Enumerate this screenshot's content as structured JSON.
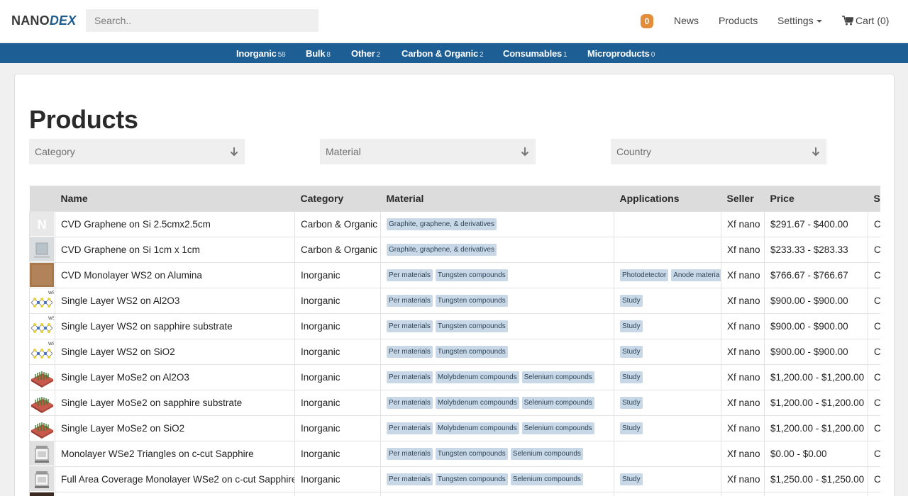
{
  "header": {
    "logo_main": "NANO",
    "logo_accent": "DEX",
    "search_placeholder": "Search..",
    "notif_count": "0",
    "nav": {
      "news": "News",
      "products": "Products",
      "settings": "Settings",
      "cart": "Cart (0)"
    }
  },
  "categories": [
    {
      "name": "Inorganic",
      "count": "58"
    },
    {
      "name": "Bulk",
      "count": "8"
    },
    {
      "name": "Other",
      "count": "2"
    },
    {
      "name": "Carbon & Organic",
      "count": "2"
    },
    {
      "name": "Consumables",
      "count": "1"
    },
    {
      "name": "Microproducts",
      "count": "0"
    }
  ],
  "page": {
    "title": "Products"
  },
  "filters": {
    "category": "Category",
    "material": "Material",
    "country": "Country"
  },
  "table": {
    "headers": {
      "name": "Name",
      "category": "Category",
      "material": "Material",
      "applications": "Applications",
      "seller": "Seller",
      "price": "Price",
      "ship": "Sh"
    },
    "rows": [
      {
        "thumb": "letter-n",
        "name": "CVD Graphene on Si 2.5cmx2.5cm",
        "category": "Carbon & Organic",
        "materials": [
          "Graphite, graphene, & derivatives"
        ],
        "applications": [],
        "seller": "Xf nano",
        "price": "$291.67 - $400.00",
        "ship": "C"
      },
      {
        "thumb": "wafer-photo",
        "name": "CVD Graphene on Si 1cm x 1cm",
        "category": "Carbon & Organic",
        "materials": [
          "Graphite, graphene, & derivatives"
        ],
        "applications": [],
        "seller": "Xf nano",
        "price": "$233.33 - $283.33",
        "ship": "C"
      },
      {
        "thumb": "brown-sample",
        "name": "CVD Monolayer WS2 on Alumina",
        "category": "Inorganic",
        "materials": [
          "Per materials",
          "Tungsten compounds"
        ],
        "applications": [
          "Photodetector",
          "Anode materia"
        ],
        "seller": "Xf nano",
        "price": "$766.67 - $766.67",
        "ship": "C"
      },
      {
        "thumb": "ws2-lattice",
        "name": "Single Layer WS2 on Al2O3",
        "category": "Inorganic",
        "materials": [
          "Per materials",
          "Tungsten compounds"
        ],
        "applications": [
          "Study"
        ],
        "seller": "Xf nano",
        "price": "$900.00 - $900.00",
        "ship": "C"
      },
      {
        "thumb": "ws2-lattice",
        "name": "Single Layer WS2 on sapphire substrate",
        "category": "Inorganic",
        "materials": [
          "Per materials",
          "Tungsten compounds"
        ],
        "applications": [
          "Study"
        ],
        "seller": "Xf nano",
        "price": "$900.00 - $900.00",
        "ship": "C"
      },
      {
        "thumb": "ws2-lattice",
        "name": "Single Layer WS2 on SiO2",
        "category": "Inorganic",
        "materials": [
          "Per materials",
          "Tungsten compounds"
        ],
        "applications": [
          "Study"
        ],
        "seller": "Xf nano",
        "price": "$900.00 - $900.00",
        "ship": "C"
      },
      {
        "thumb": "mose2-crystal",
        "name": "Single Layer MoSe2 on Al2O3",
        "category": "Inorganic",
        "materials": [
          "Per materials",
          "Molybdenum compounds",
          "Selenium compounds"
        ],
        "applications": [
          "Study"
        ],
        "seller": "Xf nano",
        "price": "$1,200.00 - $1,200.00",
        "ship": "C"
      },
      {
        "thumb": "mose2-crystal",
        "name": "Single Layer MoSe2 on sapphire substrate",
        "category": "Inorganic",
        "materials": [
          "Per materials",
          "Molybdenum compounds",
          "Selenium compounds"
        ],
        "applications": [
          "Study"
        ],
        "seller": "Xf nano",
        "price": "$1,200.00 - $1,200.00",
        "ship": "C"
      },
      {
        "thumb": "mose2-crystal",
        "name": "Single Layer MoSe2 on SiO2",
        "category": "Inorganic",
        "materials": [
          "Per materials",
          "Molybdenum compounds",
          "Selenium compounds"
        ],
        "applications": [
          "Study"
        ],
        "seller": "Xf nano",
        "price": "$1,200.00 - $1,200.00",
        "ship": "C"
      },
      {
        "thumb": "sample-box",
        "name": "Monolayer WSe2 Triangles on c-cut Sapphire",
        "category": "Inorganic",
        "materials": [
          "Per materials",
          "Tungsten compounds",
          "Selenium compounds"
        ],
        "applications": [],
        "seller": "Xf nano",
        "price": "$0.00 - $0.00",
        "ship": "C"
      },
      {
        "thumb": "sample-box",
        "name": "Full Area Coverage Monolayer WSe2 on c-cut Sapphire",
        "category": "Inorganic",
        "materials": [
          "Per materials",
          "Tungsten compounds",
          "Selenium compounds"
        ],
        "applications": [
          "Study"
        ],
        "seller": "Xf nano",
        "price": "$1,250.00 - $1,250.00",
        "ship": "C"
      },
      {
        "thumb": "dark-sample",
        "name": "",
        "category": "",
        "materials": [],
        "applications": [],
        "seller": "",
        "price": "",
        "ship": ""
      }
    ]
  },
  "colors": {
    "brand_blue": "#1d5f94",
    "badge_orange": "#e38d3b",
    "tag_bg": "#c9d8e7",
    "header_bg": "#dcdcdc"
  }
}
